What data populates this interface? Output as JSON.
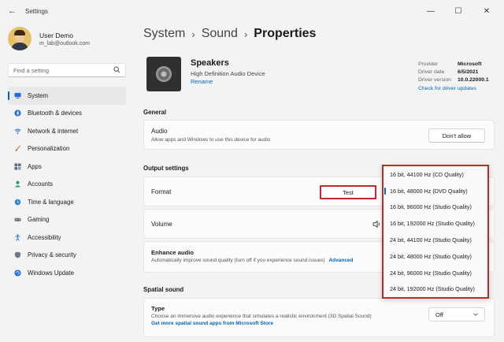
{
  "window": {
    "title": "Settings",
    "back_glyph": "←",
    "minimize_glyph": "—",
    "maximize_glyph": "☐",
    "close_glyph": "✕"
  },
  "user": {
    "name": "User Demo",
    "email": "m_lab@outlook.com"
  },
  "search": {
    "placeholder": "Find a setting"
  },
  "nav": {
    "items": [
      {
        "label": "System",
        "icon": "monitor-icon",
        "active": true
      },
      {
        "label": "Bluetooth & devices",
        "icon": "bluetooth-icon"
      },
      {
        "label": "Network & internet",
        "icon": "wifi-icon"
      },
      {
        "label": "Personalization",
        "icon": "brush-icon"
      },
      {
        "label": "Apps",
        "icon": "apps-icon"
      },
      {
        "label": "Accounts",
        "icon": "person-icon"
      },
      {
        "label": "Time & language",
        "icon": "globe-clock-icon"
      },
      {
        "label": "Gaming",
        "icon": "gamepad-icon"
      },
      {
        "label": "Accessibility",
        "icon": "accessibility-icon"
      },
      {
        "label": "Privacy & security",
        "icon": "shield-icon"
      },
      {
        "label": "Windows Update",
        "icon": "update-icon"
      }
    ]
  },
  "breadcrumb": {
    "items": [
      "System",
      "Sound",
      "Properties"
    ],
    "separator": "›"
  },
  "device": {
    "name": "Speakers",
    "description": "High Definition Audio Device",
    "rename": "Rename",
    "icon": "speaker-icon"
  },
  "driver": {
    "provider_label": "Provider",
    "provider": "Microsoft",
    "date_label": "Driver date",
    "date": "6/5/2021",
    "version_label": "Driver version",
    "version": "10.0.22000.1",
    "updates_link": "Check for driver updates"
  },
  "general": {
    "title": "General",
    "audio_title": "Audio",
    "audio_sub": "Allow apps and Windows to use this device for audio",
    "dont_allow": "Don't allow"
  },
  "output": {
    "title": "Output settings",
    "format_label": "Format",
    "test_label": "Test",
    "volume_label": "Volume",
    "enhance_title": "Enhance audio",
    "enhance_sub": "Automatically improve sound quality (turn off if you experience sound issues)",
    "advanced": "Advanced"
  },
  "format_options": {
    "selected_index": 1,
    "items": [
      "16 bit, 44100 Hz (CD Quality)",
      "16 bit, 48000 Hz (DVD Quality)",
      "16 bit, 96000 Hz (Studio Quality)",
      "16 bit, 192000 Hz (Studio Quality)",
      "24 bit, 44100 Hz (Studio Quality)",
      "24 bit, 48000 Hz (Studio Quality)",
      "24 bit, 96000 Hz (Studio Quality)",
      "24 bit, 192000 Hz (Studio Quality)"
    ]
  },
  "spatial": {
    "title": "Spatial sound",
    "type_title": "Type",
    "type_sub": "Choose an immersive audio experience that simulates a realistic environment (3D Spatial Sound)",
    "store_link": "Get more spatial sound apps from Microsoft Store",
    "selected": "Off"
  },
  "colors": {
    "accent": "#0067c0",
    "highlight_box": "#c62828",
    "background": "#f3f3f3",
    "card": "#fbfbfb"
  }
}
